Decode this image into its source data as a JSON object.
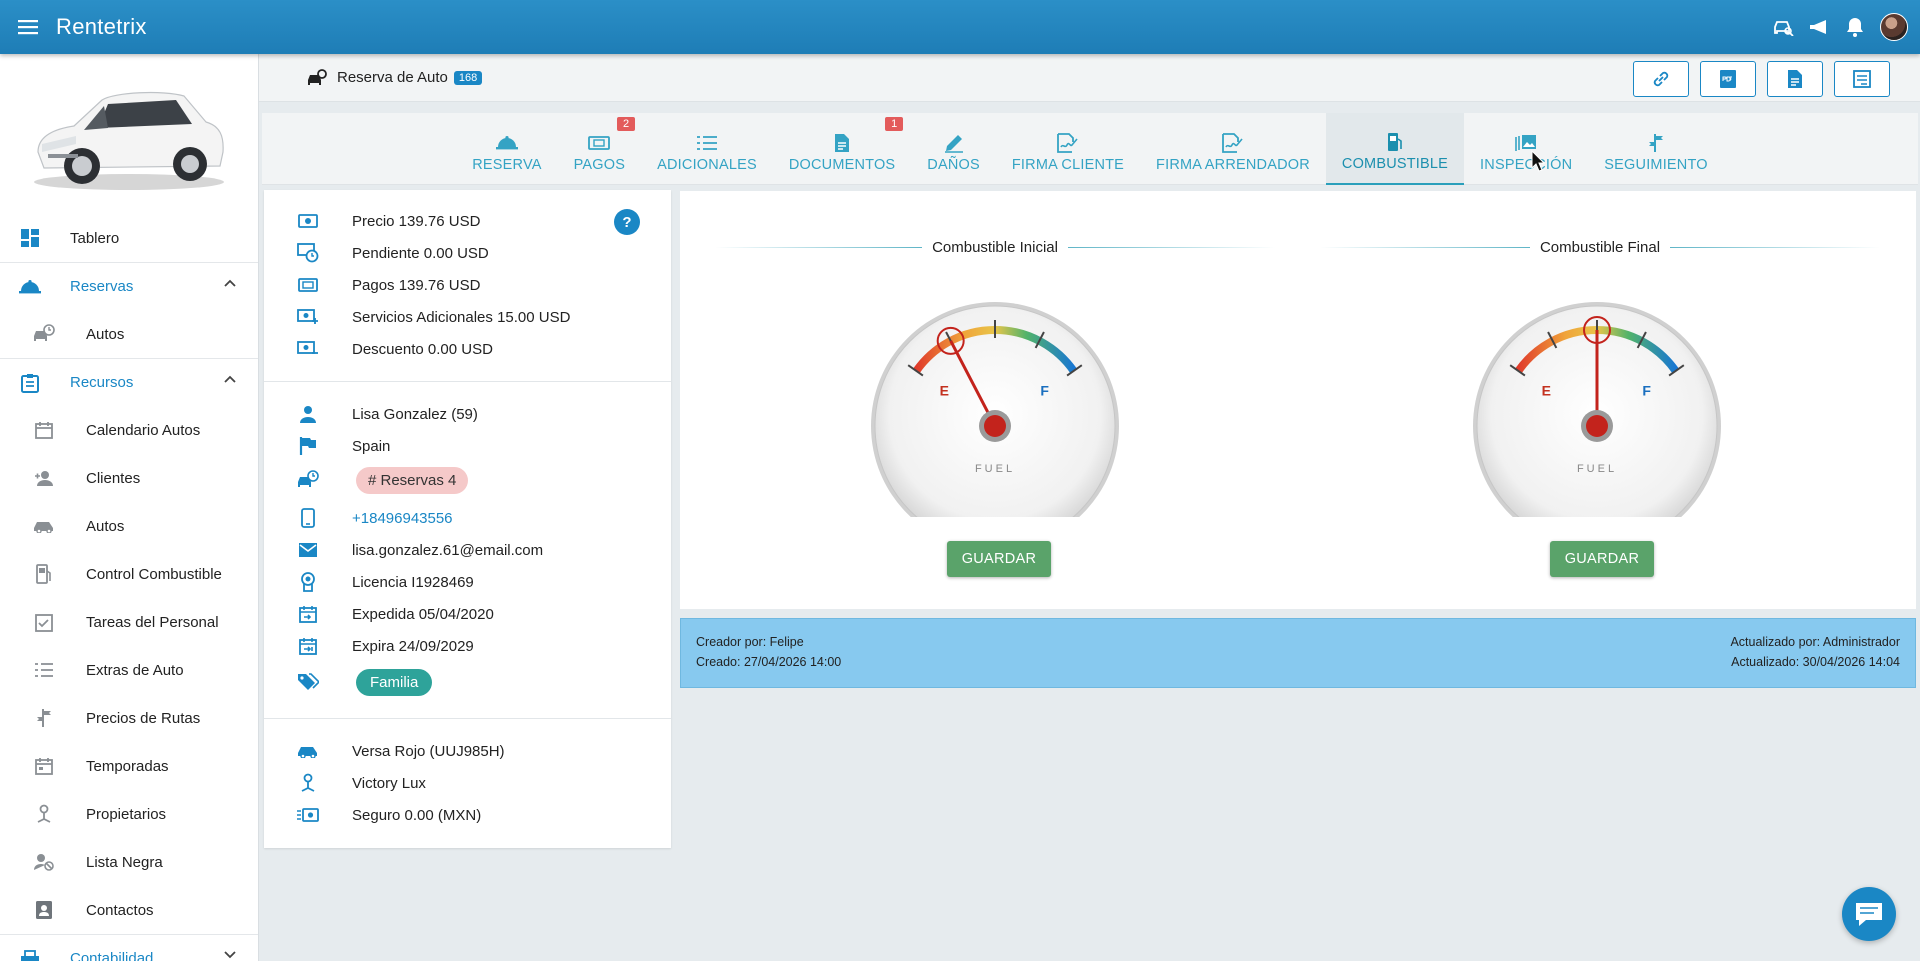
{
  "app": {
    "title": "Rentetrix"
  },
  "sidebar": {
    "items": [
      {
        "label": "Tablero",
        "icon": "dashboard-icon"
      },
      {
        "label": "Reservas",
        "icon": "reservation-bell-icon",
        "section": true,
        "expanded": true
      },
      {
        "label": "Autos",
        "icon": "car-clock-icon"
      },
      {
        "label": "Recursos",
        "icon": "clipboard-icon",
        "section": true,
        "expanded": true
      },
      {
        "label": "Calendario Autos",
        "icon": "calendar-icon"
      },
      {
        "label": "Clientes",
        "icon": "users-icon"
      },
      {
        "label": "Autos",
        "icon": "car-icon"
      },
      {
        "label": "Control Combustible",
        "icon": "fuel-pump-icon"
      },
      {
        "label": "Tareas del Personal",
        "icon": "tasks-icon"
      },
      {
        "label": "Extras de Auto",
        "icon": "list-icon"
      },
      {
        "label": "Precios de Rutas",
        "icon": "signpost-icon"
      },
      {
        "label": "Temporadas",
        "icon": "calendar-range-icon"
      },
      {
        "label": "Propietarios",
        "icon": "owner-icon"
      },
      {
        "label": "Lista Negra",
        "icon": "blocked-user-icon"
      },
      {
        "label": "Contactos",
        "icon": "contacts-icon"
      },
      {
        "label": "Contabilidad",
        "icon": "accounting-icon",
        "section": true,
        "expanded": false
      }
    ]
  },
  "header": {
    "title": "Reserva de Auto",
    "badge": "168"
  },
  "tabs": [
    {
      "label": "RESERVA",
      "icon": "bell-icon"
    },
    {
      "label": "PAGOS",
      "icon": "money-icon",
      "badge": "2"
    },
    {
      "label": "ADICIONALES",
      "icon": "list-icon"
    },
    {
      "label": "DOCUMENTOS",
      "icon": "document-icon",
      "badge": "1"
    },
    {
      "label": "DAÑOS",
      "icon": "pencil-icon"
    },
    {
      "label": "FIRMA CLIENTE",
      "icon": "signature-icon"
    },
    {
      "label": "FIRMA ARRENDADOR",
      "icon": "signature-icon"
    },
    {
      "label": "COMBUSTIBLE",
      "icon": "fuel-pump-icon",
      "active": true
    },
    {
      "label": "INSPECCIÓN",
      "icon": "gallery-icon"
    },
    {
      "label": "SEGUIMIENTO",
      "icon": "signpost-icon"
    }
  ],
  "summary": {
    "precio": "Precio 139.76 USD",
    "pendiente": "Pendiente 0.00 USD",
    "pagos": "Pagos 139.76 USD",
    "servicios": "Servicios Adicionales 15.00 USD",
    "descuento": "Descuento 0.00 USD",
    "help": "?"
  },
  "customer": {
    "name": "Lisa Gonzalez (59)",
    "country": "Spain",
    "reservations": "# Reservas 4",
    "phone": "+18496943556",
    "email": "lisa.gonzalez.61@email.com",
    "license": "Licencia I1928469",
    "issued": "Expedida 05/04/2020",
    "expires": "Expira 24/09/2029",
    "tag": "Familia"
  },
  "vehicle": {
    "car": "Versa Rojo (UUJ985H)",
    "owner": "Victory Lux",
    "insurance": "Seguro 0.00 (MXN)"
  },
  "fuel": {
    "initial": {
      "title": "Combustible Inicial",
      "level": 0.25,
      "save_label": "GUARDAR",
      "e": "E",
      "f": "F",
      "caption": "FUEL"
    },
    "final": {
      "title": "Combustible Final",
      "level": 0.5,
      "save_label": "GUARDAR",
      "e": "E",
      "f": "F",
      "caption": "FUEL"
    }
  },
  "audit": {
    "creator": "Creador por: Felipe",
    "created": "Creado: 27/04/2026 14:00",
    "updater": "Actualizado por: Administrador",
    "updated": "Actualizado: 30/04/2026 14:04"
  },
  "colors": {
    "primary": "#1a87c5",
    "accent": "#2a9fbb",
    "save": "#5aa36a",
    "badge": "#e35b5b"
  }
}
